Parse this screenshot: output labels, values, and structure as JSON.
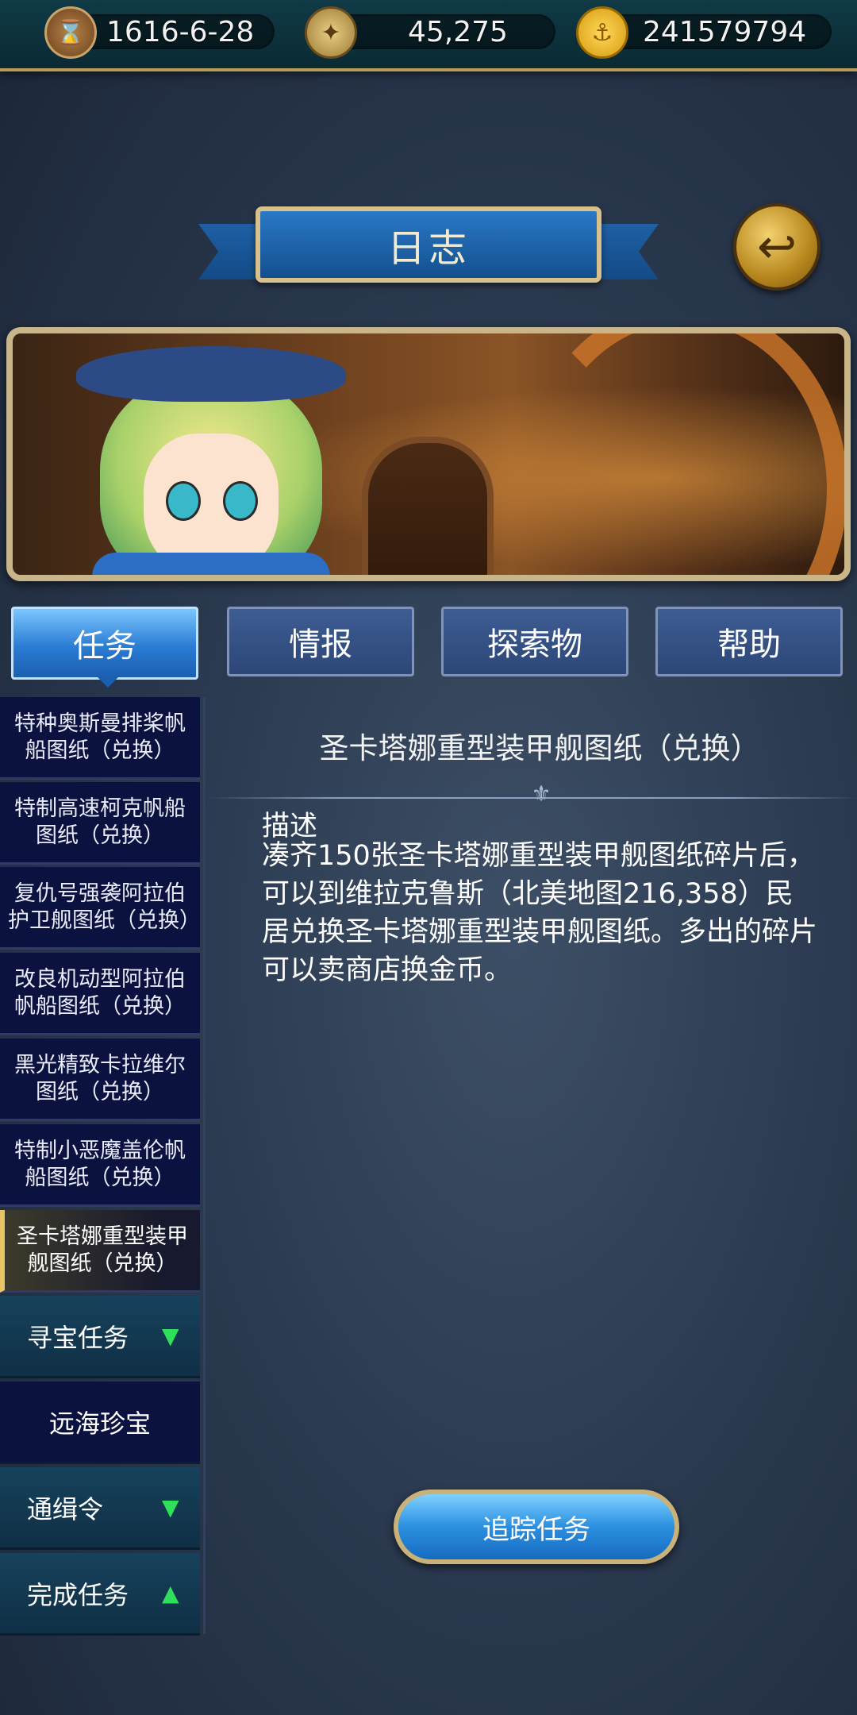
{
  "status": {
    "date": "1616-6-28",
    "compass_value": "45,275",
    "gold": "241579794"
  },
  "header": {
    "title": "日志",
    "back_icon": "back-arrow-icon"
  },
  "tabs": [
    {
      "label": "任务",
      "active": true
    },
    {
      "label": "情报",
      "active": false
    },
    {
      "label": "探索物",
      "active": false
    },
    {
      "label": "帮助",
      "active": false
    }
  ],
  "quests": [
    {
      "label": "特种奥斯曼排桨帆船图纸（兑换）"
    },
    {
      "label": "特制高速柯克帆船图纸（兑换）"
    },
    {
      "label": "复仇号强袭阿拉伯护卫舰图纸（兑换）"
    },
    {
      "label": "改良机动型阿拉伯帆船图纸（兑换）"
    },
    {
      "label": "黑光精致卡拉维尔图纸（兑换）"
    },
    {
      "label": "特制小恶魔盖伦帆船图纸（兑换）"
    },
    {
      "label": "圣卡塔娜重型装甲舰图纸（兑换）",
      "selected": true
    }
  ],
  "categories": [
    {
      "label": "寻宝任务",
      "arrow": "▼"
    },
    {
      "label": "远海珍宝",
      "arrow": ""
    },
    {
      "label": "通缉令",
      "arrow": "▼"
    },
    {
      "label": "完成任务",
      "arrow": "▲"
    }
  ],
  "detail": {
    "title": "圣卡塔娜重型装甲舰图纸（兑换）",
    "desc_heading": "描述",
    "desc_body": "凑齐150张圣卡塔娜重型装甲舰图纸碎片后，可以到维拉克鲁斯（北美地图216,358）民居兑换圣卡塔娜重型装甲舰图纸。多出的碎片可以卖商店换金币。"
  },
  "actions": {
    "track_label": "追踪任务"
  },
  "colors": {
    "accent_blue": "#2a7cd4",
    "gold_border": "#c9b58a",
    "list_bg": "#0b1240",
    "arrow_green": "#2ee05a"
  }
}
